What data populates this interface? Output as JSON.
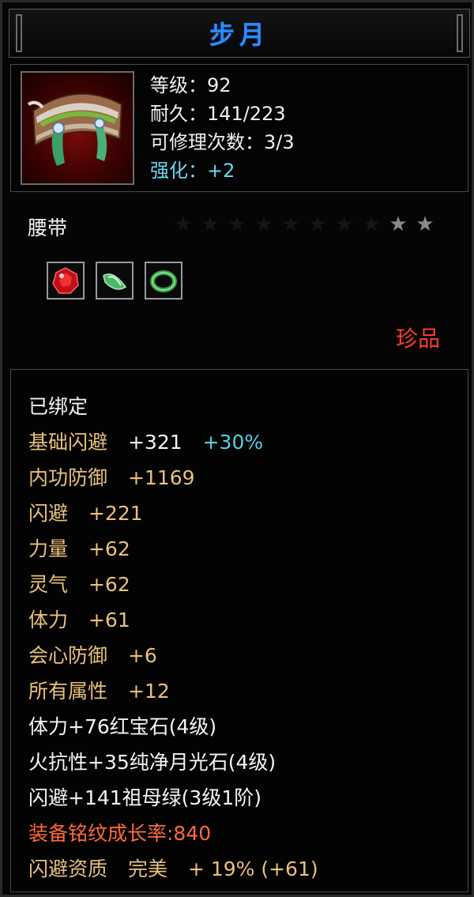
{
  "title": "步月",
  "header": {
    "level": "等级：92",
    "durability": "耐久：141/223",
    "repair_count": "可修理次数：3/3",
    "enhance": "强化：+2"
  },
  "item_type": "腰带",
  "stars": {
    "filled": 2,
    "total": 10
  },
  "rarity": "珍品",
  "gems": [
    "ruby-gem-icon",
    "jade-gem-icon",
    "emerald-ring-icon"
  ],
  "attributes": {
    "bound": "已绑定",
    "base_dodge_label": "基础闪避",
    "base_dodge_value": "+321",
    "base_dodge_bonus": "+30%",
    "internal_def_label": "内功防御",
    "internal_def_value": "+1169",
    "dodge_label": "闪避",
    "dodge_value": "+221",
    "strength_label": "力量",
    "strength_value": "+62",
    "spirit_label": "灵气",
    "spirit_value": "+62",
    "stamina_label": "体力",
    "stamina_value": "+61",
    "crit_def_label": "会心防御",
    "crit_def_value": "+6",
    "all_attr_label": "所有属性",
    "all_attr_value": "+12",
    "gem_line_1": "体力+76红宝石(4级)",
    "gem_line_2": "火抗性+35纯净月光石(4级)",
    "gem_line_3": "闪避+141祖母绿(3级1阶)",
    "inscription_growth": "装备铭纹成长率:840",
    "quality_label": "闪避资质",
    "quality_grade": "完美",
    "quality_value": "+ 19% (+61)"
  },
  "colors": {
    "title": "#2d8dff",
    "enhance": "#6ad6f0",
    "attribute": "#e8c07a",
    "rarity": "#ff3b28",
    "growth": "#ff6a3a",
    "bonus": "#58d0e0"
  }
}
